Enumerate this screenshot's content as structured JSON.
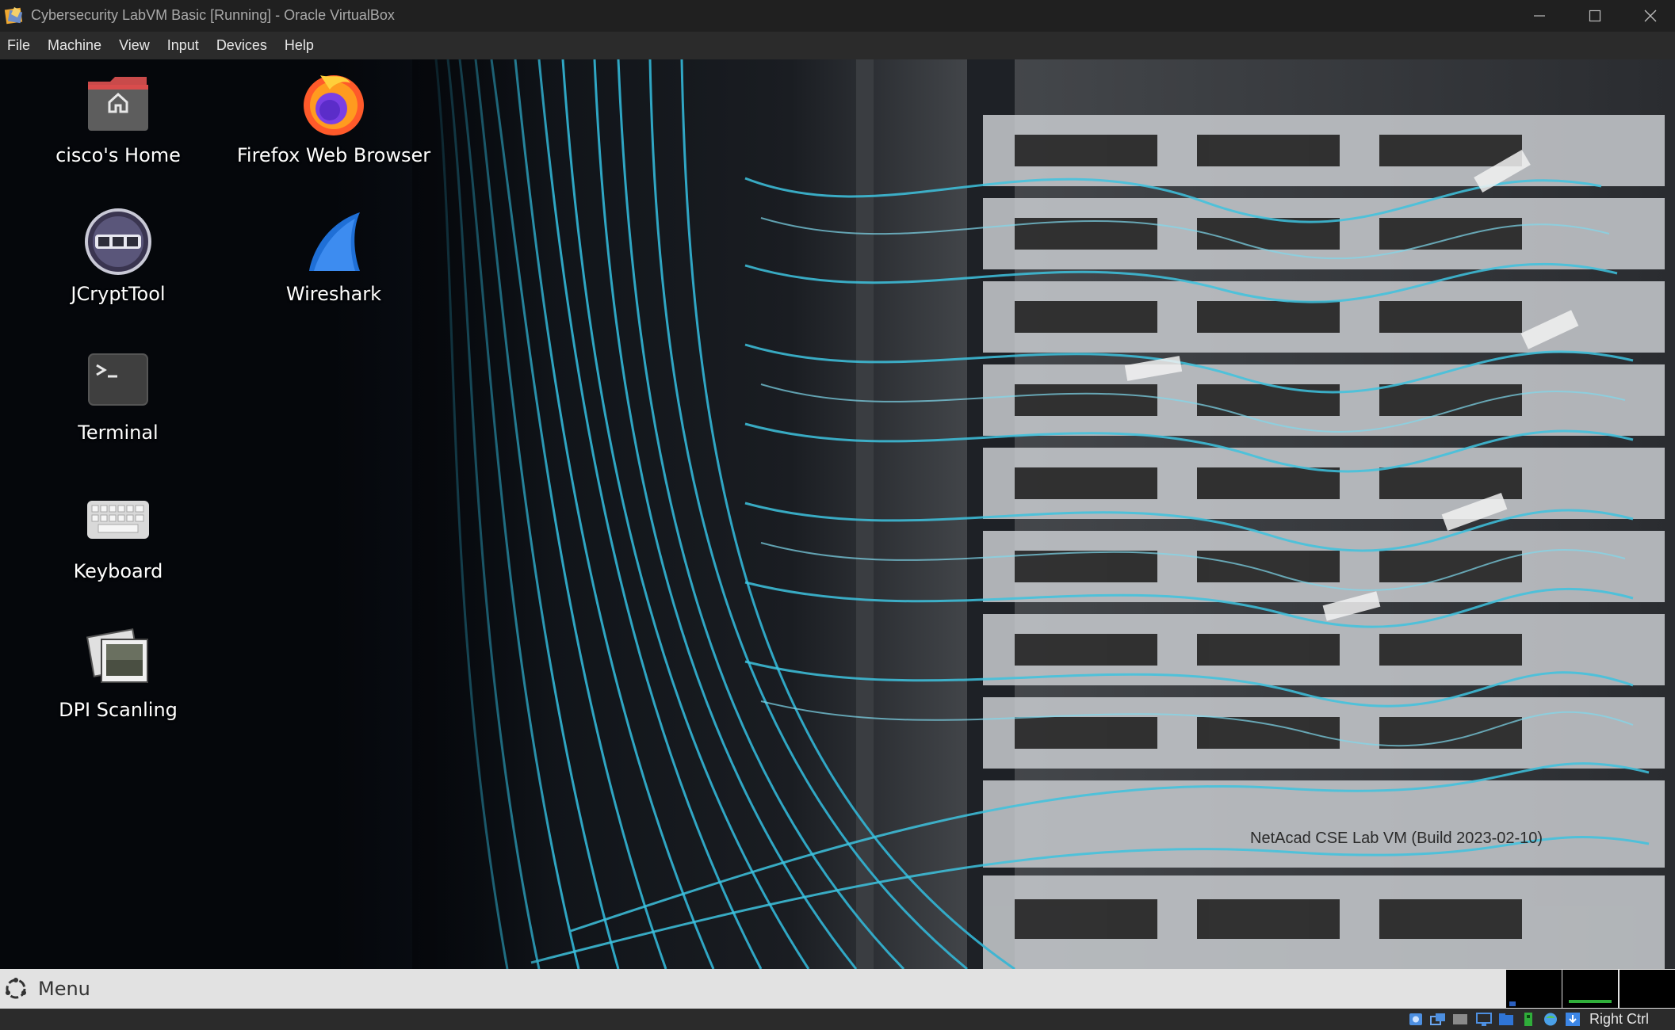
{
  "window": {
    "title": "Cybersecurity LabVM Basic [Running] - Oracle VirtualBox"
  },
  "menubar": {
    "items": [
      "File",
      "Machine",
      "View",
      "Input",
      "Devices",
      "Help"
    ]
  },
  "desktop": {
    "icons": [
      {
        "label": "cisco's Home",
        "icon": "home-folder-icon"
      },
      {
        "label": "Firefox Web Browser",
        "icon": "firefox-icon"
      },
      {
        "label": "JCryptTool",
        "icon": "jcrypttool-icon"
      },
      {
        "label": "Wireshark",
        "icon": "wireshark-icon"
      },
      {
        "label": "Terminal",
        "icon": "terminal-icon"
      },
      {
        "label": "Keyboard",
        "icon": "keyboard-icon"
      },
      {
        "label": "DPI Scanling",
        "icon": "dpi-scaling-icon"
      }
    ],
    "wallpaper_caption": "NetAcad CSE Lab VM (Build 2023-02-10)"
  },
  "panel": {
    "menu_label": "Menu",
    "workspaces": 3
  },
  "statusbar": {
    "host_key": "Right Ctrl",
    "icons": [
      "hard-disk-icon",
      "optical-drive-icon",
      "audio-icon",
      "display-icon",
      "shared-folders-icon",
      "usb-icon",
      "network-icon",
      "recording-icon",
      "mouse-integration-icon",
      "keyboard-capture-icon"
    ]
  },
  "colors": {
    "titlebar": "#202020",
    "menubar": "#2b2b2b",
    "panel": "#e2e2e2",
    "cable": "#33b6d6"
  }
}
